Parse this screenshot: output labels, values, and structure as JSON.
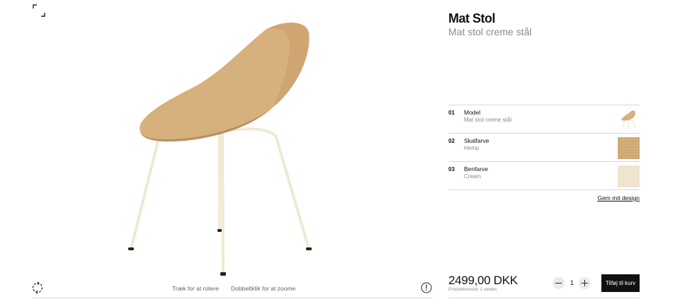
{
  "viewer": {
    "hint_rotate": "Træk for at rotere",
    "hint_zoom": "Dobbeltklik for at zoome",
    "icons": [
      "expand-icon",
      "rotate-360-icon",
      "info-icon"
    ]
  },
  "product": {
    "title": "Mat Stol",
    "subtitle": "Mat stol creme stål"
  },
  "options": [
    {
      "num": "01",
      "label": "Model",
      "value": "Mat stol creme stål",
      "thumb": "chair-thumbnail"
    },
    {
      "num": "02",
      "label": "Skalfarve",
      "value": "Hemp",
      "swatch": "#d3ae7c"
    },
    {
      "num": "03",
      "label": "Benfarve",
      "value": "Cream",
      "swatch": "#efe4cf"
    }
  ],
  "save_design_label": "Gem mit design",
  "purchase": {
    "price": "2499,00 DKK",
    "lead_time": "Produktionstid: 2 weeks",
    "quantity": "1",
    "add_to_cart_label": "Tilføj til kurv"
  },
  "colors": {
    "shell": "#d6b07d",
    "legs": "#f2edd8",
    "button": "#111111"
  }
}
